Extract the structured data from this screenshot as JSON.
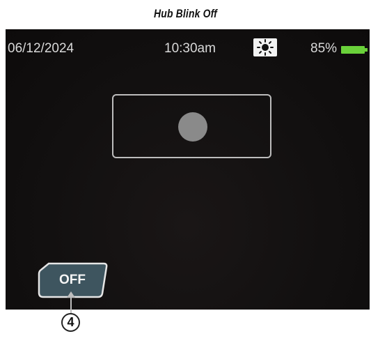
{
  "caption": "Hub Blink Off",
  "status_bar": {
    "date": "06/12/2024",
    "time": "10:30am",
    "brightness_icon": "sun-icon",
    "battery_percent_text": "85%",
    "battery_color": "#6ad13a"
  },
  "hub": {
    "led_state": "off",
    "led_color": "#8a8a8a"
  },
  "off_button": {
    "label": "OFF"
  },
  "callout": {
    "number": "4"
  }
}
